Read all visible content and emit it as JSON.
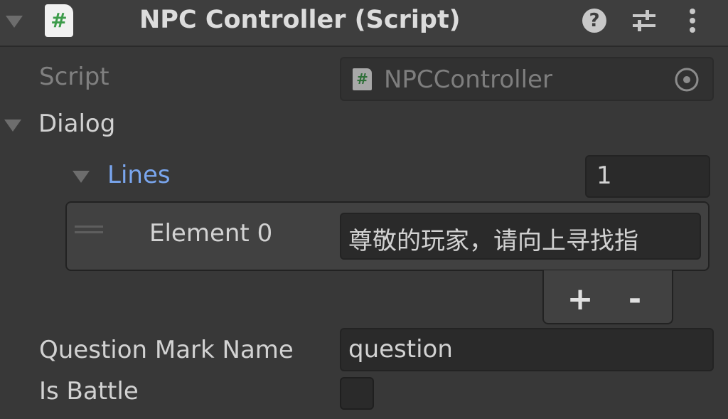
{
  "component": {
    "title": "NPC Controller (Script)",
    "icon": "csharp-script-icon",
    "icon_glyph": "#",
    "help_glyph": "?",
    "header_icons": [
      "help-icon",
      "presets-icon",
      "context-menu-icon"
    ]
  },
  "fields": {
    "script": {
      "label": "Script",
      "value": "NPCController",
      "icon_glyph": "#"
    },
    "dialog": {
      "label": "Dialog",
      "expanded": true
    },
    "lines": {
      "label": "Lines",
      "size": "1",
      "elements": [
        {
          "label": "Element 0",
          "value": "尊敬的玩家，请向上寻找指"
        }
      ],
      "add_label": "+",
      "remove_label": "-"
    },
    "question_mark_name": {
      "label": "Question Mark Name",
      "value": "question"
    },
    "is_battle": {
      "label": "Is Battle",
      "checked": false
    }
  },
  "colors": {
    "background": "#383838",
    "header": "#3e3e3e",
    "field": "#2a2a2a",
    "accent_label": "#7aa6ee",
    "script_icon_hash": "#3c9b4a"
  }
}
